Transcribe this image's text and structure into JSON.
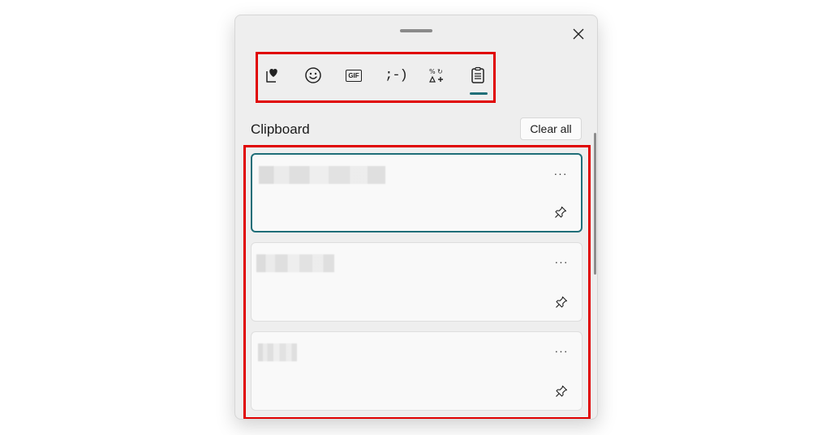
{
  "tabs": [
    {
      "id": "favorites",
      "icon": "heart-note-icon",
      "label": "Favorites"
    },
    {
      "id": "emoji",
      "icon": "smiley-icon",
      "label": "Emoji"
    },
    {
      "id": "gif",
      "icon": "gif-icon",
      "label": "GIF"
    },
    {
      "id": "kaomoji",
      "icon": "kaomoji-icon",
      "label": ";-)"
    },
    {
      "id": "symbols",
      "icon": "symbols-icon",
      "label": "Symbols"
    },
    {
      "id": "clipboard",
      "icon": "clipboard-icon",
      "label": "Clipboard"
    }
  ],
  "gif_label": "GIF",
  "kaomoji_label": ";-)",
  "selected_tab": "clipboard",
  "section": {
    "title": "Clipboard",
    "clear_all_label": "Clear all"
  },
  "clipboard_items": [
    {
      "text": "██████████ ████",
      "selected": true,
      "more_label": "···"
    },
    {
      "text": "██████████",
      "selected": false,
      "more_label": "···"
    },
    {
      "text": "████",
      "selected": false,
      "more_label": "···"
    }
  ],
  "colors": {
    "accent": "#1f6e78",
    "highlight_box": "#e00000",
    "panel_bg": "#eeeeee"
  }
}
